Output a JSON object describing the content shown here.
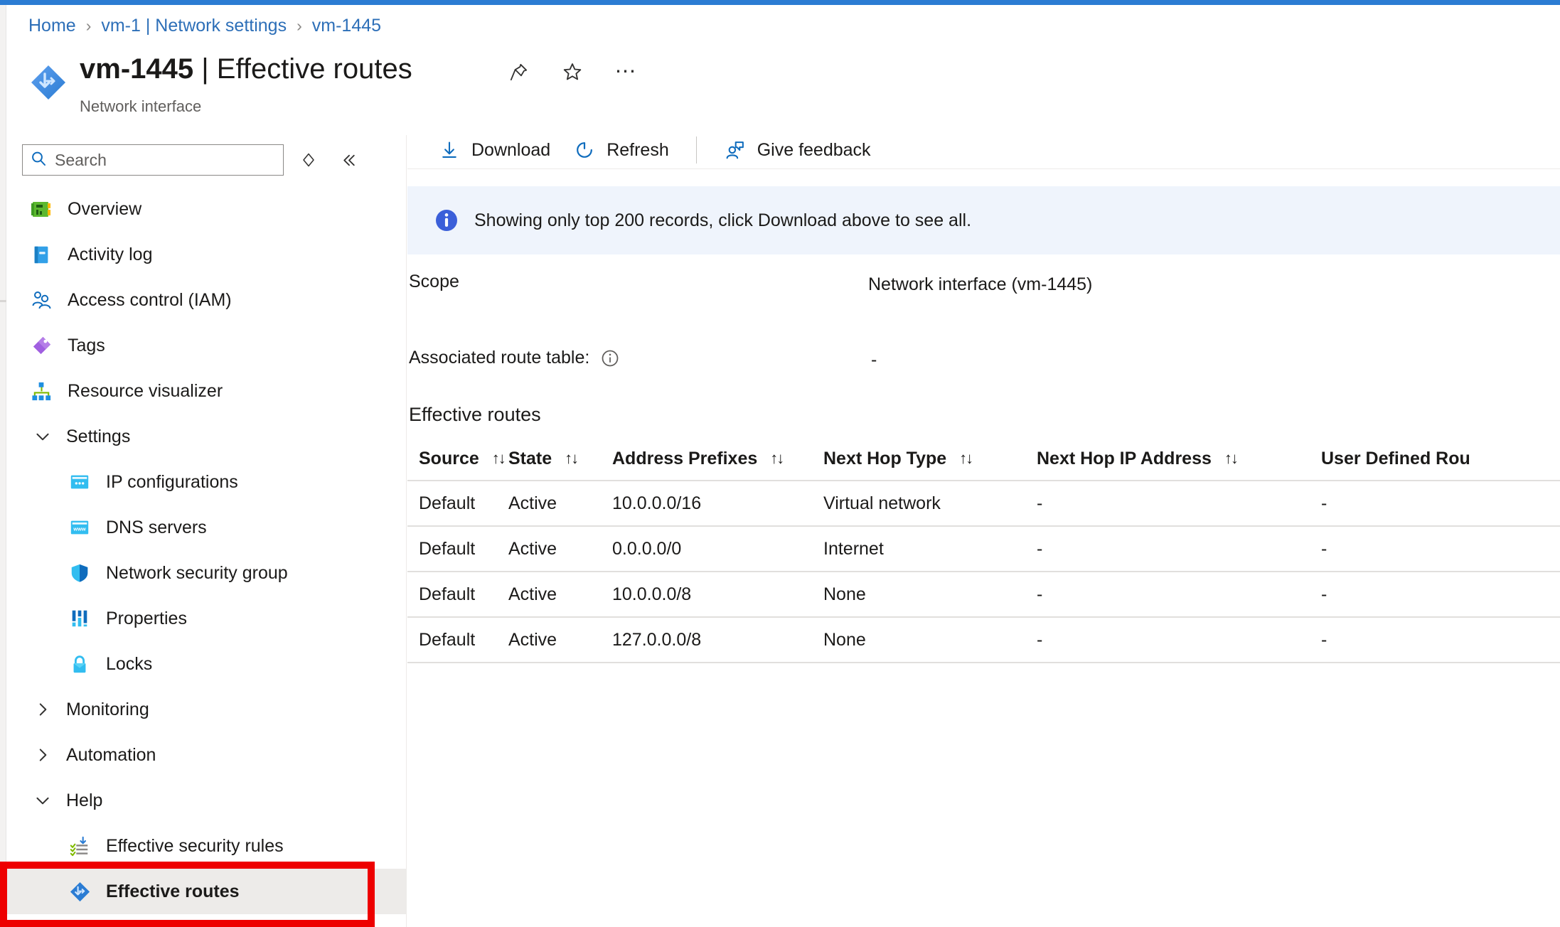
{
  "breadcrumb": {
    "items": [
      {
        "label": "Home"
      },
      {
        "label": "vm-1 | Network settings"
      },
      {
        "label": "vm-1445"
      }
    ],
    "separator": "›"
  },
  "header": {
    "resource_name": "vm-1445",
    "separator": "|",
    "page": "Effective routes",
    "subtitle": "Network interface",
    "actions": [
      {
        "name": "pin-icon",
        "tooltip": "Pin to dashboard"
      },
      {
        "name": "favorite-star-icon",
        "tooltip": "Add to favorites"
      },
      {
        "name": "more-ellipsis-icon",
        "tooltip": "More",
        "glyph": "⋯"
      }
    ]
  },
  "sidebar": {
    "search": {
      "placeholder": "Search",
      "value": ""
    },
    "controls": [
      {
        "name": "expand-collapse-icon",
        "glyph": "◇"
      },
      {
        "name": "collapse-sidebar-icon",
        "glyph": "«"
      }
    ],
    "items": [
      {
        "label": "Overview",
        "icon": "overview-icon",
        "type": "item"
      },
      {
        "label": "Activity log",
        "icon": "activity-log-icon",
        "type": "item"
      },
      {
        "label": "Access control (IAM)",
        "icon": "access-control-icon",
        "type": "item"
      },
      {
        "label": "Tags",
        "icon": "tags-icon",
        "type": "item"
      },
      {
        "label": "Resource visualizer",
        "icon": "resource-visualizer-icon",
        "type": "item"
      },
      {
        "label": "Settings",
        "icon": "chevron-down-icon",
        "type": "group",
        "expanded": true
      },
      {
        "label": "IP configurations",
        "icon": "ip-configurations-icon",
        "type": "child"
      },
      {
        "label": "DNS servers",
        "icon": "dns-servers-icon",
        "type": "child"
      },
      {
        "label": "Network security group",
        "icon": "shield-icon",
        "type": "child"
      },
      {
        "label": "Properties",
        "icon": "properties-icon",
        "type": "child"
      },
      {
        "label": "Locks",
        "icon": "lock-icon",
        "type": "child"
      },
      {
        "label": "Monitoring",
        "icon": "chevron-right-icon",
        "type": "group",
        "expanded": false
      },
      {
        "label": "Automation",
        "icon": "chevron-right-icon",
        "type": "group",
        "expanded": false
      },
      {
        "label": "Help",
        "icon": "chevron-down-icon",
        "type": "group",
        "expanded": true
      },
      {
        "label": "Effective security rules",
        "icon": "effective-security-rules-icon",
        "type": "child"
      },
      {
        "label": "Effective routes",
        "icon": "effective-routes-icon",
        "type": "child",
        "selected": true
      }
    ]
  },
  "toolbar": {
    "download_label": "Download",
    "refresh_label": "Refresh",
    "feedback_label": "Give feedback"
  },
  "banner": {
    "icon": "info-icon",
    "text": "Showing only top 200 records, click Download above to see all."
  },
  "details": {
    "scope_label": "Scope",
    "scope_value": "Network interface (vm-1445)",
    "route_table_label": "Associated route table:",
    "route_table_info_icon": "info-circle-icon",
    "route_table_value": "-"
  },
  "table": {
    "title": "Effective routes",
    "sort_glyph": "↑↓",
    "columns": [
      "Source",
      "State",
      "Address Prefixes",
      "Next Hop Type",
      "Next Hop IP Address",
      "User Defined Rou"
    ],
    "rows": [
      {
        "source": "Default",
        "state": "Active",
        "address_prefixes": "10.0.0.0/16",
        "next_hop_type": "Virtual network",
        "next_hop_ip": "-",
        "user_defined_route": "-"
      },
      {
        "source": "Default",
        "state": "Active",
        "address_prefixes": "0.0.0.0/0",
        "next_hop_type": "Internet",
        "next_hop_ip": "-",
        "user_defined_route": "-"
      },
      {
        "source": "Default",
        "state": "Active",
        "address_prefixes": "10.0.0.0/8",
        "next_hop_type": "None",
        "next_hop_ip": "-",
        "user_defined_route": "-"
      },
      {
        "source": "Default",
        "state": "Active",
        "address_prefixes": "127.0.0.0/8",
        "next_hop_type": "None",
        "next_hop_ip": "-",
        "user_defined_route": "-"
      }
    ]
  },
  "colors": {
    "accent_blue": "#0f6cbd",
    "topbar_blue": "#2b7cd3",
    "banner_bg": "#eff4fc",
    "highlight_red": "#ee0000",
    "selected_bg": "#edebe9"
  }
}
